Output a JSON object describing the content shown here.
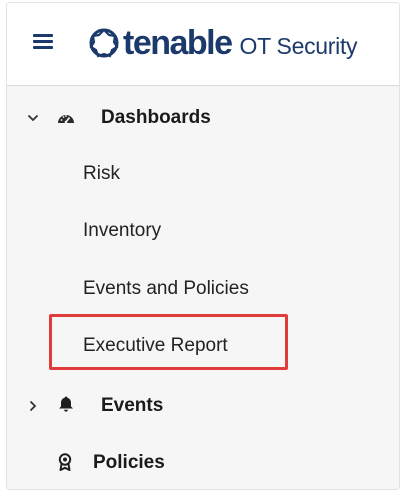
{
  "header": {
    "brand_name": "tenable",
    "product_name": "OT Security"
  },
  "nav": {
    "dashboards": {
      "label": "Dashboards",
      "icon": "dashboard-gauge-icon",
      "expanded": true,
      "children": [
        {
          "label": "Risk"
        },
        {
          "label": "Inventory"
        },
        {
          "label": "Events and Policies"
        },
        {
          "label": "Executive Report",
          "highlighted": true
        }
      ]
    },
    "events": {
      "label": "Events",
      "icon": "bell-icon",
      "expanded": false
    },
    "policies": {
      "label": "Policies",
      "icon": "award-ribbon-icon"
    }
  },
  "colors": {
    "brand": "#1b3a6b",
    "highlight": "#e03c3c",
    "sidebar_bg": "#f6f6f6"
  }
}
